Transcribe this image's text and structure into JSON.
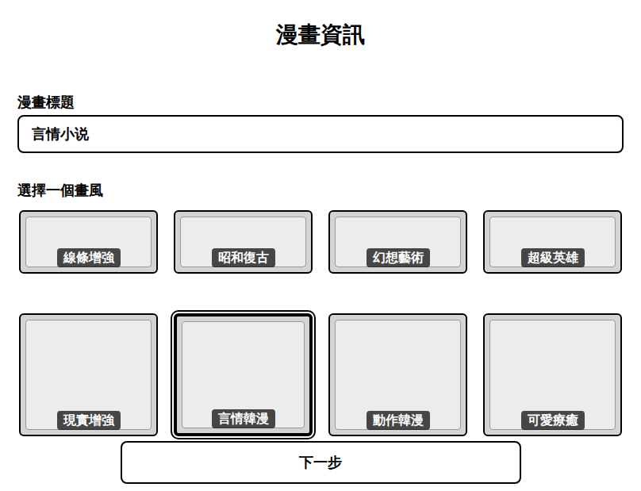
{
  "page": {
    "title": "漫畫資訊"
  },
  "title_field": {
    "label": "漫畫標題",
    "value": "言情小说"
  },
  "styles": {
    "label": "選擇一個畫風",
    "items": [
      {
        "label": "線條增強",
        "selected": false
      },
      {
        "label": "昭和復古",
        "selected": false
      },
      {
        "label": "幻想藝術",
        "selected": false
      },
      {
        "label": "超級英雄",
        "selected": false
      },
      {
        "label": "現實增強",
        "selected": false
      },
      {
        "label": "言情韓漫",
        "selected": true
      },
      {
        "label": "動作韓漫",
        "selected": false
      },
      {
        "label": "可愛療癒",
        "selected": false
      }
    ]
  },
  "buttons": {
    "next": "下一步"
  }
}
